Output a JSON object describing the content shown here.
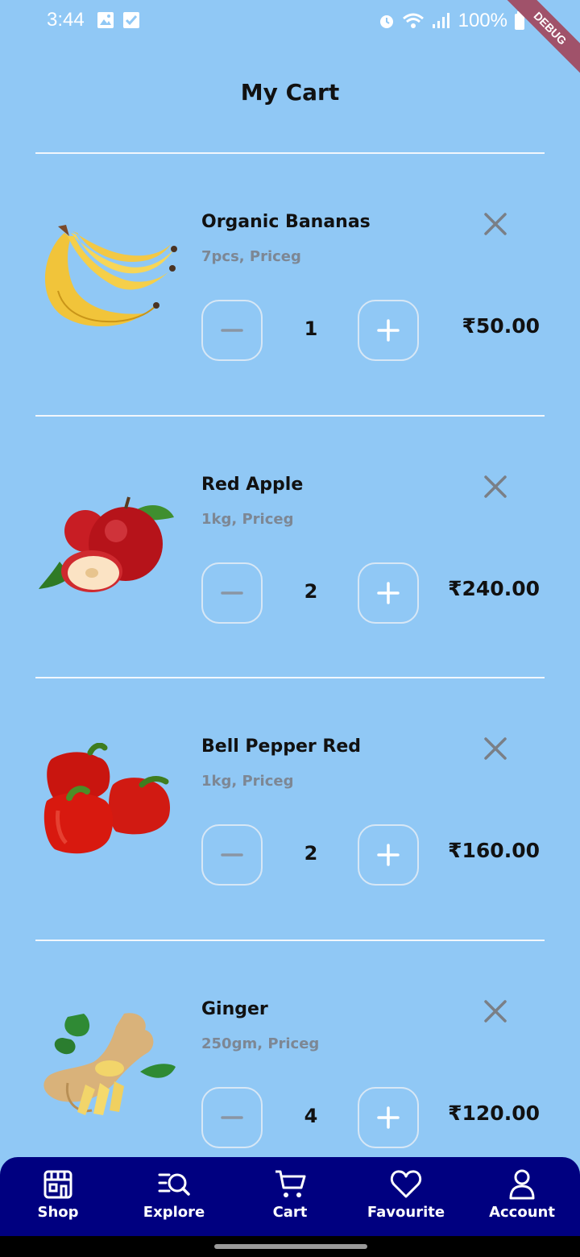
{
  "status": {
    "time": "3:44",
    "battery": "100%",
    "debug_label": "DEBUG"
  },
  "title": "My Cart",
  "colors": {
    "background": "#90c8f5",
    "nav_background": "#000080",
    "text": "#111111",
    "secondary_text": "#7d8794"
  },
  "items": [
    {
      "name": "Organic Bananas",
      "detail": "7pcs, Priceg",
      "quantity": "1",
      "price": "₹50.00",
      "image_icon": "banana-icon"
    },
    {
      "name": "Red Apple",
      "detail": "1kg, Priceg",
      "quantity": "2",
      "price": "₹240.00",
      "image_icon": "apple-icon"
    },
    {
      "name": "Bell Pepper Red",
      "detail": "1kg, Priceg",
      "quantity": "2",
      "price": "₹160.00",
      "image_icon": "bell-pepper-icon"
    },
    {
      "name": "Ginger",
      "detail": "250gm, Priceg",
      "quantity": "4",
      "price": "₹120.00",
      "image_icon": "ginger-icon"
    }
  ],
  "nav": [
    {
      "label": "Shop",
      "icon": "store-icon"
    },
    {
      "label": "Explore",
      "icon": "explore-icon"
    },
    {
      "label": "Cart",
      "icon": "cart-icon"
    },
    {
      "label": "Favourite",
      "icon": "heart-icon"
    },
    {
      "label": "Account",
      "icon": "account-icon"
    }
  ]
}
